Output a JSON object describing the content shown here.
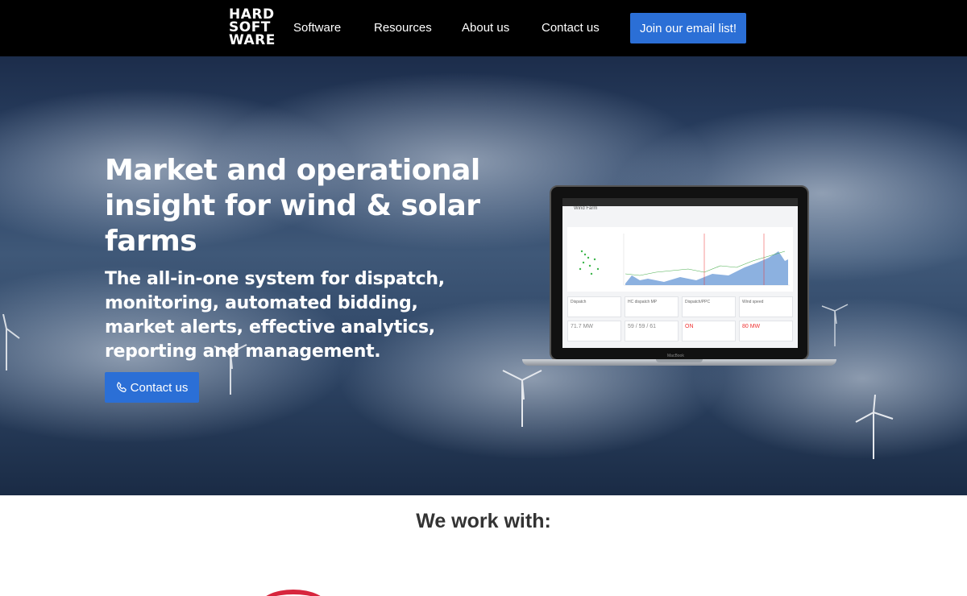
{
  "header": {
    "logo_lines": [
      "HARD",
      "SOFT",
      "WARE"
    ],
    "nav": [
      "Software",
      "Resources",
      "About us",
      "Contact us"
    ],
    "email_button": "Join our email list!"
  },
  "hero": {
    "title": "Market and operational insight for wind & solar farms",
    "subtitle": "The all-in-one system for dispatch, monitoring, automated bidding, market alerts, effective analytics, reporting and management.",
    "contact_button": "Contact us",
    "laptop_label": "MacBook",
    "screen": {
      "header": "Wind Farm",
      "cards": [
        {
          "label": "Dispatch",
          "value": "71.7 MW"
        },
        {
          "label": "HC dispatch MP",
          "value": "59 / 59 / 61"
        },
        {
          "label": "Dispatch/PPC",
          "value": "ON"
        },
        {
          "label": "Wind speed",
          "value": "80 MW"
        }
      ]
    }
  },
  "partners": {
    "title": "We work with:"
  },
  "colors": {
    "accent": "#2b6fd6",
    "header_bg": "#000000",
    "partner_red": "#d7263d"
  },
  "icons": {
    "contact_button_icon": "phone-icon"
  }
}
